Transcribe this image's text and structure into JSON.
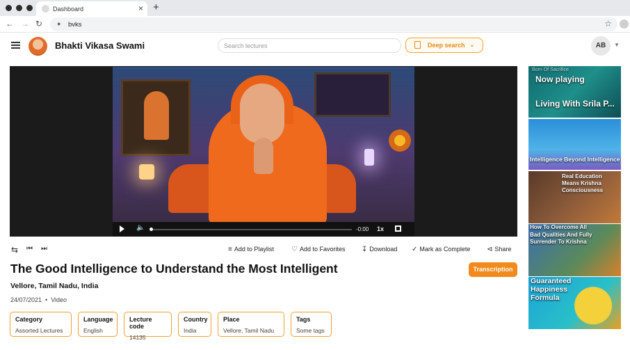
{
  "browser": {
    "tab_title": "Dashboard",
    "url": "bvks",
    "close_glyph": "×",
    "newtab_glyph": "+"
  },
  "header": {
    "brand": "Bhakti Vikasa Swami",
    "search_placeholder": "Search lectures",
    "deep_search_label": "Deep search",
    "avatar_initials": "AB"
  },
  "player": {
    "time": "-0:00",
    "speed": "1x",
    "progress": 0
  },
  "actions": {
    "add_to_playlist": "Add to Playlist",
    "add_to_favorites": "Add to Favorites",
    "download": "Download",
    "mark_complete": "Mark as Complete",
    "share": "Share"
  },
  "lecture": {
    "title": "The Good Intelligence to Understand the Most Intelligent",
    "location": "Vellore, Tamil Nadu, India",
    "date": "24/07/2021",
    "date_sep": "•",
    "media_type": "Video",
    "transcription_label": "Transcription",
    "meta": [
      {
        "key": "Category",
        "value": "Assorted Lectures"
      },
      {
        "key": "Language",
        "value": "English"
      },
      {
        "key": "Lecture code",
        "value": "14135"
      },
      {
        "key": "Country",
        "value": "India"
      },
      {
        "key": "Place",
        "value": "Vellore, Tamil Nadu"
      },
      {
        "key": "Tags",
        "value": "Some tags"
      }
    ]
  },
  "sidebar": {
    "now_playing_label": "Now playing",
    "items": [
      {
        "overlay": "Born Of Sacrifice",
        "title": "Living With Srila P..."
      },
      {
        "title": "Intelligence Beyond Intelligence"
      },
      {
        "title": "Real Education Means Krishna Consciousness"
      },
      {
        "title": "How To Overcome All Bad Qualities And Fully Surrender To Krishna"
      },
      {
        "title": "Guaranteed Happiness Formula"
      }
    ]
  },
  "colors": {
    "accent": "#f28a1c",
    "chip_border": "#f0a030"
  }
}
